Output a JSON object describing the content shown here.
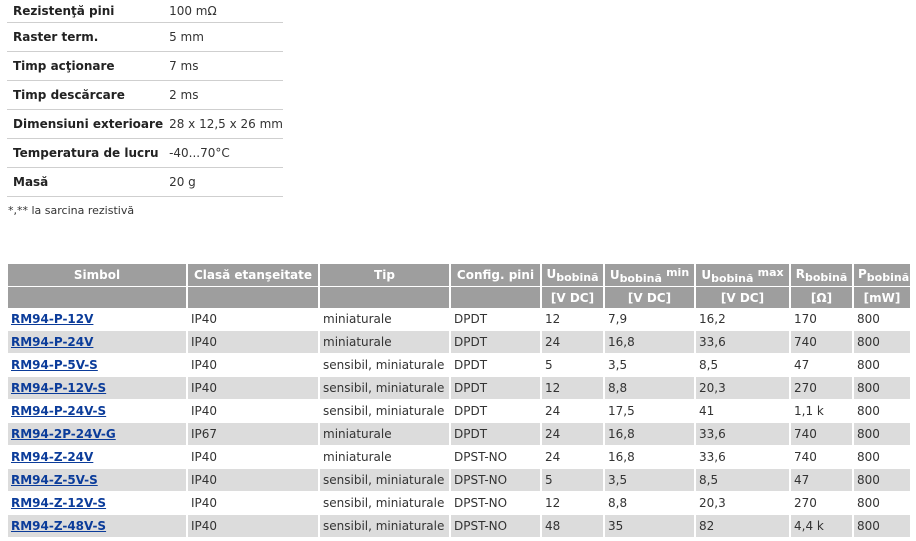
{
  "specs": [
    {
      "label": "Rezistenţă pini",
      "value": "100 mΩ"
    },
    {
      "label": "Raster term.",
      "value": "5 mm"
    },
    {
      "label": "Timp acţionare",
      "value": "7 ms"
    },
    {
      "label": "Timp descărcare",
      "value": "2 ms"
    },
    {
      "label": "Dimensiuni exterioare",
      "value": "28 x 12,5 x 26 mm"
    },
    {
      "label": "Temperatura de lucru",
      "value": "-40...70°C"
    },
    {
      "label": "Masă",
      "value": "20 g"
    }
  ],
  "note": "*,** la sarcina rezistivă",
  "table": {
    "headers": {
      "simbol": "Simbol",
      "clasa": "Clasă etanşeitate",
      "tip": "Tip",
      "config": "Config. pini",
      "u_main": "U",
      "u_sub": "bobină",
      "umin_main": "U",
      "umin_sub": "bobină",
      "umin_sup": "min",
      "umax_main": "U",
      "umax_sub": "bobină",
      "umax_sup": "max",
      "r_main": "R",
      "r_sub": "bobină",
      "p_main": "P",
      "p_sub": "bobină"
    },
    "units": [
      "",
      "",
      "",
      "",
      "[V DC]",
      "[V DC]",
      "[V DC]",
      "[Ω]",
      "[mW]"
    ],
    "rows": [
      [
        "RM94-P-12V",
        "IP40",
        "miniaturale",
        "DPDT",
        "12",
        "7,9",
        "16,2",
        "170",
        "800"
      ],
      [
        "RM94-P-24V",
        "IP40",
        "miniaturale",
        "DPDT",
        "24",
        "16,8",
        "33,6",
        "740",
        "800"
      ],
      [
        "RM94-P-5V-S",
        "IP40",
        "sensibil, miniaturale",
        "DPDT",
        "5",
        "3,5",
        "8,5",
        "47",
        "800"
      ],
      [
        "RM94-P-12V-S",
        "IP40",
        "sensibil, miniaturale",
        "DPDT",
        "12",
        "8,8",
        "20,3",
        "270",
        "800"
      ],
      [
        "RM94-P-24V-S",
        "IP40",
        "sensibil, miniaturale",
        "DPDT",
        "24",
        "17,5",
        "41",
        "1,1 k",
        "800"
      ],
      [
        "RM94-2P-24V-G",
        "IP67",
        "miniaturale",
        "DPDT",
        "24",
        "16,8",
        "33,6",
        "740",
        "800"
      ],
      [
        "RM94-Z-24V",
        "IP40",
        "miniaturale",
        "DPST-NO",
        "24",
        "16,8",
        "33,6",
        "740",
        "800"
      ],
      [
        "RM94-Z-5V-S",
        "IP40",
        "sensibil, miniaturale",
        "DPST-NO",
        "5",
        "3,5",
        "8,5",
        "47",
        "800"
      ],
      [
        "RM94-Z-12V-S",
        "IP40",
        "sensibil, miniaturale",
        "DPST-NO",
        "12",
        "8,8",
        "20,3",
        "270",
        "800"
      ],
      [
        "RM94-Z-48V-S",
        "IP40",
        "sensibil, miniaturale",
        "DPST-NO",
        "48",
        "35",
        "82",
        "4,4 k",
        "800"
      ]
    ]
  }
}
